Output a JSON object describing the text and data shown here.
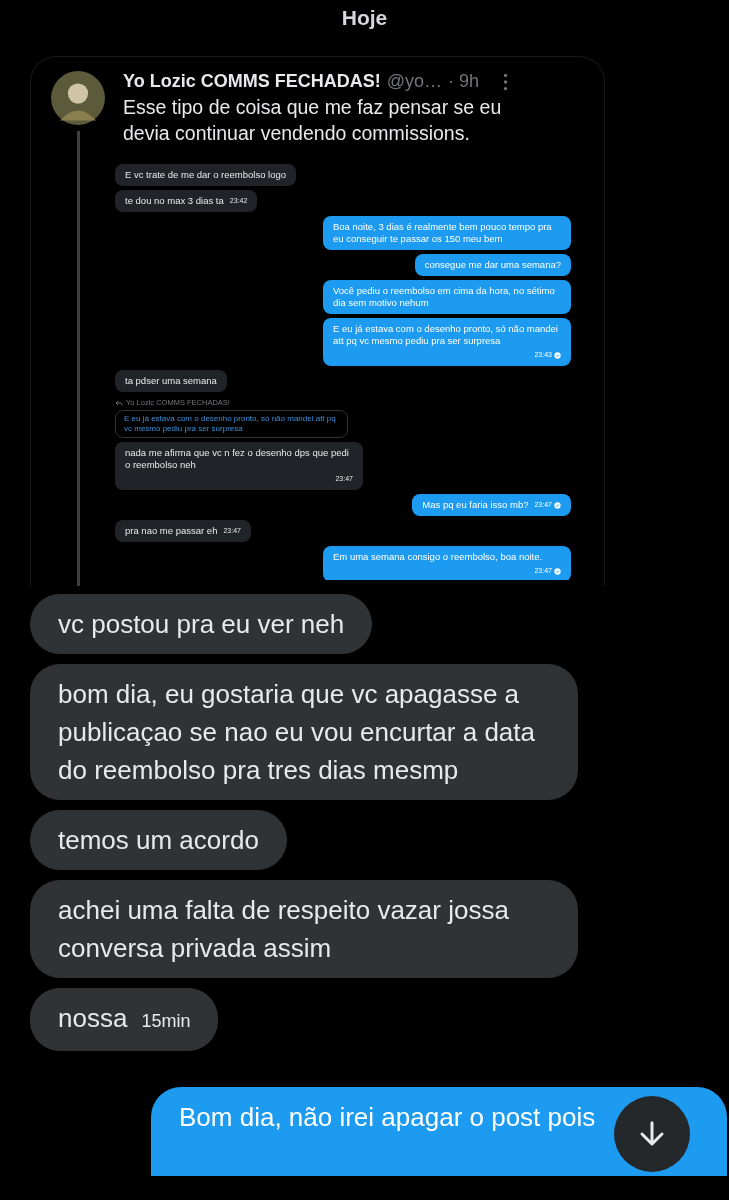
{
  "date": "Hoje",
  "tweet": {
    "author": "Yo Lozic COMMS FECHADAS!",
    "handle": "@yo…",
    "time": "· 9h",
    "text": "Esse tipo de coisa que me faz pensar se eu devia continuar vendendo commissions.",
    "attachment": {
      "messages": [
        {
          "kind": "received",
          "text": "E vc trate de me dar o reembolso logo"
        },
        {
          "kind": "received",
          "text": "te dou no max 3 dias ta",
          "time": "23:42"
        },
        {
          "kind": "sent",
          "text": "Boa noite, 3 dias é realmente bem pouco tempo pra eu conseguir te passar os 150 meu bem"
        },
        {
          "kind": "sent",
          "text": "consegue me dar uma semana?"
        },
        {
          "kind": "sent",
          "text": "Você pediu o reembolso em cima da hora, no sétimo dia sem motivo nehum"
        },
        {
          "kind": "sent",
          "text": "E eu já estava com o desenho pronto, só não mandei att pq vc mesmo pediu pra ser surpresa",
          "time": "23:43"
        },
        {
          "kind": "received",
          "text": "ta pdser uma semana"
        },
        {
          "kind": "quote",
          "author": "Yo Lozic COMMS FECHADAS!",
          "text": "E eu já estava com o desenho pronto, só não mandei att pq vc mesmo pediu pra ser surpresa"
        },
        {
          "kind": "received",
          "text": "nada me afirma que vc n fez o desenho dps que pedi o reembolso neh",
          "time": "23:47"
        },
        {
          "kind": "sent",
          "text": "Mas pq eu faria isso mb?",
          "time": "23:47"
        },
        {
          "kind": "received",
          "text": "pra nao me passar eh",
          "time": "23:47"
        },
        {
          "kind": "sent",
          "text": "Em uma semana consigo o reembolso, boa noite.",
          "time": "23:47"
        }
      ]
    }
  },
  "messages": [
    {
      "kind": "received",
      "text": "vc postou pra eu ver neh"
    },
    {
      "kind": "received",
      "text": "bom dia, eu gostaria que vc apagasse a publicaçao se nao eu vou encurtar a data do reembolso pra tres dias mesmp"
    },
    {
      "kind": "received",
      "text": "temos um acordo"
    },
    {
      "kind": "received",
      "text": "achei uma falta de respeito vazar jossa conversa privada assim"
    },
    {
      "kind": "received",
      "text": "nossa",
      "time": "15min"
    },
    {
      "kind": "sent",
      "text": "Bom dia, não irei apagar o post pois"
    }
  ]
}
